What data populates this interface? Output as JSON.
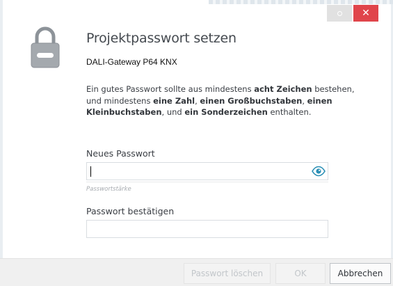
{
  "window": {
    "restore_button": "restore-icon",
    "close_label": "✕",
    "close_color": "#e0454b"
  },
  "header": {
    "title": "Projektpasswort setzen",
    "subtitle": "DALI-Gateway P64 KNX",
    "icon": "lock-icon"
  },
  "hint": {
    "p1": "Ein gutes Passwort sollte aus mindestens ",
    "b1": "acht Zeichen",
    "p2": " bestehen, und mindestens ",
    "b2": "eine Zahl",
    "p3": ", ",
    "b3": "einen Großbuchstaben",
    "p4": ", ",
    "b4": "einen Kleinbuchstaben",
    "p5": ", und ",
    "b5": "ein Sonderzeichen",
    "p6": " enthalten."
  },
  "form": {
    "new_password_label": "Neues Passwort",
    "new_password_value": "",
    "strength_label": "Passwortstärke",
    "confirm_password_label": "Passwort bestätigen",
    "confirm_password_value": "",
    "eye_icon": "eye-icon",
    "eye_color": "#2a8fb5"
  },
  "footer": {
    "delete_label": "Passwort löschen",
    "ok_label": "OK",
    "cancel_label": "Abbrechen"
  }
}
